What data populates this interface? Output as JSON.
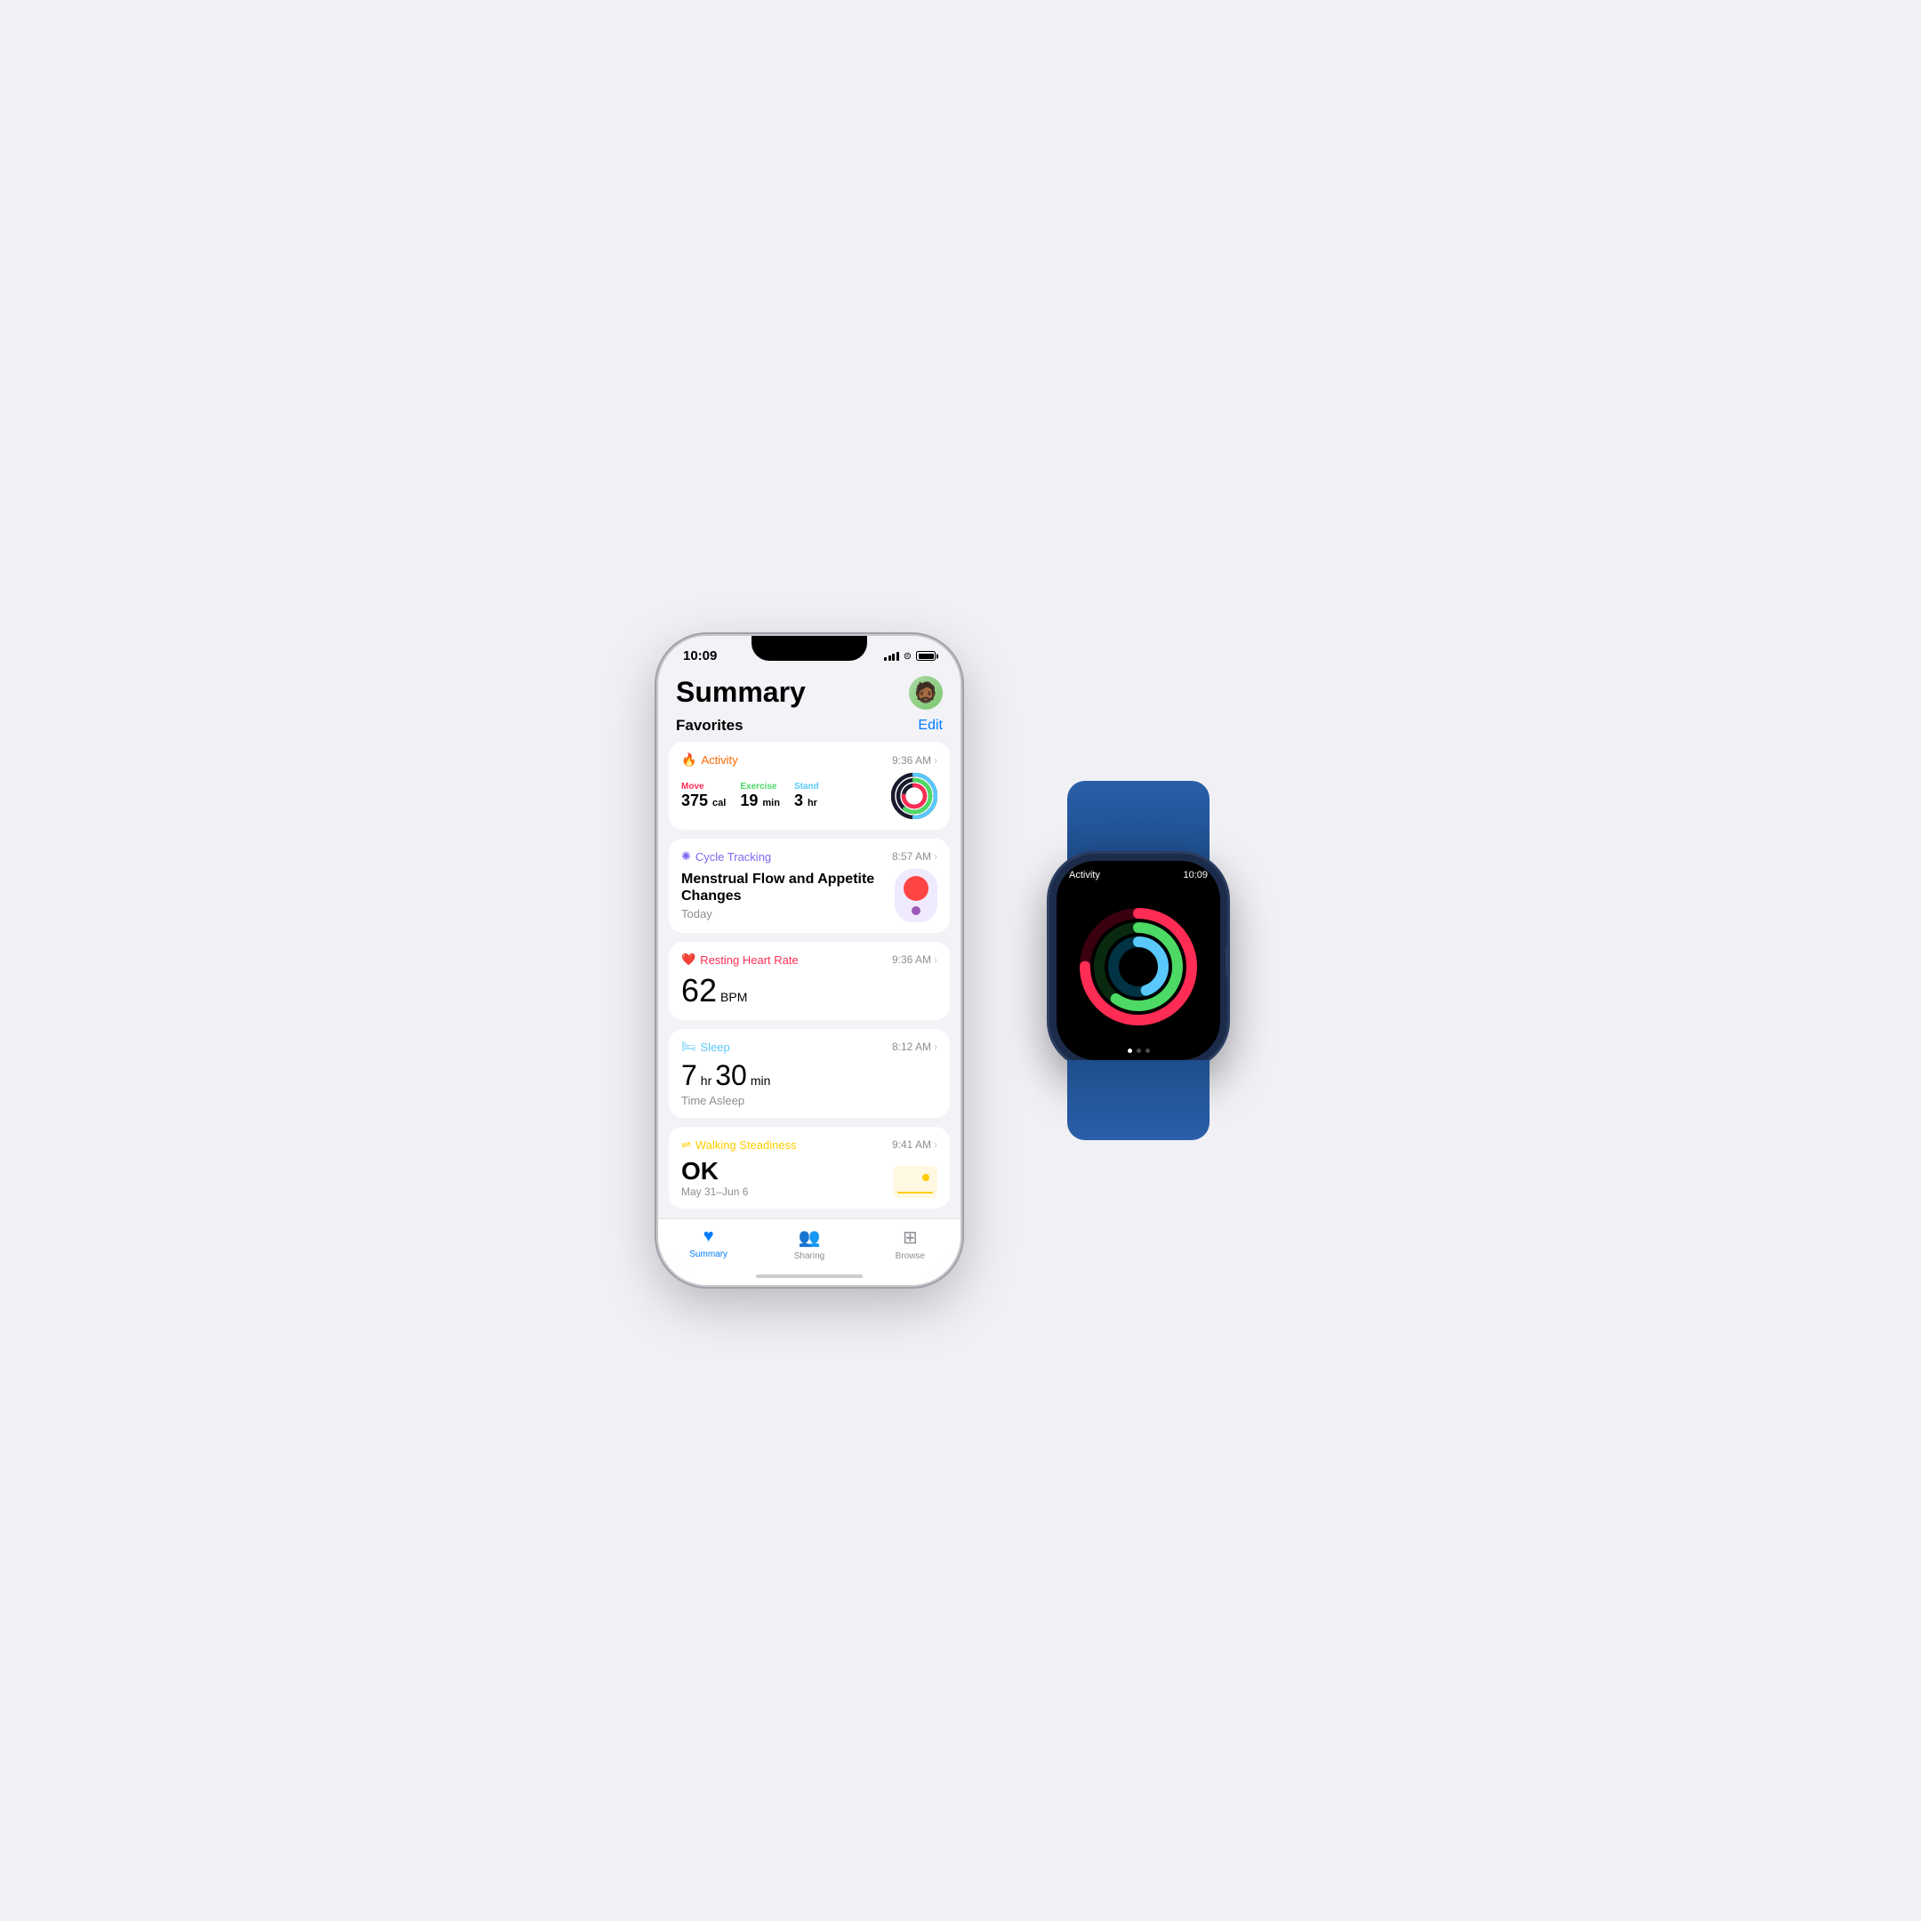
{
  "background": "#f0f0f5",
  "iphone": {
    "status_bar": {
      "time": "10:09",
      "signal": "●●●●",
      "wifi": "wifi",
      "battery": "battery"
    },
    "header": {
      "title": "Summary",
      "avatar_emoji": "🧔"
    },
    "favorites": {
      "label": "Favorites",
      "edit_label": "Edit"
    },
    "cards": [
      {
        "id": "activity",
        "title": "Activity",
        "time": "9:36 AM",
        "icon": "🔥",
        "color": "#ff6600",
        "stats": [
          {
            "label": "Move",
            "value": "375",
            "unit": "cal",
            "color": "#ff2d55"
          },
          {
            "label": "Exercise",
            "value": "19",
            "unit": "min",
            "color": "#4cd964"
          },
          {
            "label": "Stand",
            "value": "3",
            "unit": "hr",
            "color": "#5ac8fa"
          }
        ]
      },
      {
        "id": "cycle",
        "title": "Cycle Tracking",
        "time": "8:57 AM",
        "icon": "✦",
        "color": "#7b68ee",
        "heading": "Menstrual Flow and Appetite Changes",
        "subtext": "Today"
      },
      {
        "id": "heart",
        "title": "Resting Heart Rate",
        "time": "9:36 AM",
        "icon": "❤️",
        "color": "#ff2d55",
        "value": "62",
        "unit": "BPM"
      },
      {
        "id": "sleep",
        "title": "Sleep",
        "time": "8:12 AM",
        "icon": "🛏️",
        "color": "#5ac8fa",
        "hours": "7",
        "minutes": "30",
        "label": "Time Asleep"
      },
      {
        "id": "walking",
        "title": "Walking Steadiness",
        "time": "9:41 AM",
        "icon": "⇌",
        "color": "#ffcc00",
        "value": "OK",
        "range": "May 31–Jun 6"
      }
    ],
    "tabs": [
      {
        "id": "summary",
        "label": "Summary",
        "icon": "♥",
        "active": true
      },
      {
        "id": "sharing",
        "label": "Sharing",
        "icon": "👥",
        "active": false
      },
      {
        "id": "browse",
        "label": "Browse",
        "icon": "⊞",
        "active": false
      }
    ]
  },
  "watch": {
    "app_name": "Activity",
    "time": "10:09",
    "rings": {
      "move": {
        "color": "#ff2d55",
        "progress": 0.75
      },
      "exercise": {
        "color": "#4cd964",
        "progress": 0.6
      },
      "stand": {
        "color": "#5ac8fa",
        "progress": 0.45
      }
    },
    "dots": [
      true,
      false,
      false
    ]
  }
}
